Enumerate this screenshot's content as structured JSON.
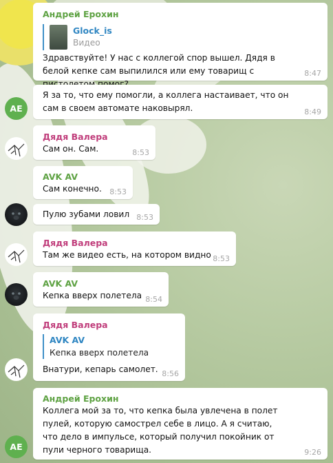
{
  "colors": {
    "andrey": "#5ea243",
    "valera": "#c03d7b",
    "avk": "#5ea243",
    "reply_accent": "#2f86c2",
    "avatar_ae": "#5fb04f"
  },
  "messages": [
    {
      "sender": "Андрей Ерохин",
      "reply": {
        "title": "Glock_is",
        "subtitle": "Видео"
      },
      "text": "Здравствуйте! У нас с коллегой спор вышел. Дядя в белой кепке сам выпилился или ему товарищ с пистолетом помог?",
      "time": "8:47"
    },
    {
      "text": "Я за то, что ему помогли, а коллега настаивает, что он сам в своем автомате наковырял.",
      "time": "8:49",
      "avatar": "AE"
    },
    {
      "sender": "Дядя Валера",
      "text": "Сам он. Сам.",
      "time": "8:53"
    },
    {
      "sender": "AVK AV",
      "text": "Сам конечно.",
      "time": "8:53"
    },
    {
      "text": "Пулю зубами ловил",
      "time": "8:53"
    },
    {
      "sender": "Дядя Валера",
      "text": "Там же видео есть, на котором видно",
      "time": "8:53"
    },
    {
      "sender": "AVK AV",
      "text": "Кепка вверх полетела",
      "time": "8:54"
    },
    {
      "sender": "Дядя Валера",
      "reply": {
        "title": "AVK AV",
        "subtitle": "Кепка вверх полетела"
      },
      "text": "Внатури, кепарь самолет.",
      "time": "8:56"
    },
    {
      "sender": "Андрей Ерохин",
      "text": "Коллега мой за то, что кепка была увлечена в полет пулей, которую самострел себе в лицо. А я считаю, что дело в импульсе, который получил покойник от пули черного товарища.",
      "time": "9:26",
      "avatar": "AE"
    }
  ]
}
